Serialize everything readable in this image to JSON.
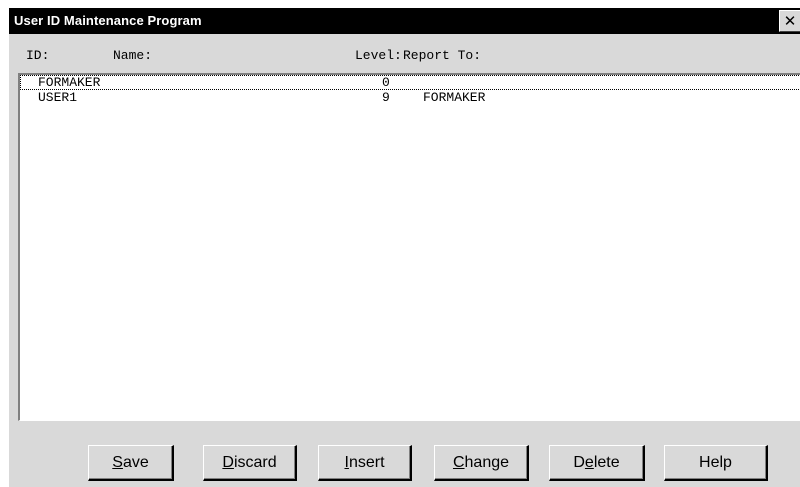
{
  "window": {
    "title": "User ID Maintenance Program",
    "close_glyph": "✕"
  },
  "columns": {
    "id": "ID:",
    "name": "Name:",
    "level": "Level:",
    "report_to": "Report To:"
  },
  "rows": [
    {
      "id": "FORMAKER",
      "name": "",
      "level": "0",
      "report_to": "",
      "selected": true
    },
    {
      "id": "USER1",
      "name": "",
      "level": "9",
      "report_to": "FORMAKER",
      "selected": false
    }
  ],
  "buttons": [
    {
      "key": "save",
      "mnemonic": "S",
      "rest": "ave"
    },
    {
      "key": "discard",
      "mnemonic": "D",
      "rest": "iscard"
    },
    {
      "key": "insert",
      "mnemonic": "I",
      "rest": "nsert"
    },
    {
      "key": "change",
      "mnemonic": "C",
      "rest": "hange"
    },
    {
      "key": "delete",
      "pre": "D",
      "mnemonic": "e",
      "rest": "lete"
    },
    {
      "key": "help",
      "mnemonic": "",
      "rest": "Help"
    }
  ]
}
